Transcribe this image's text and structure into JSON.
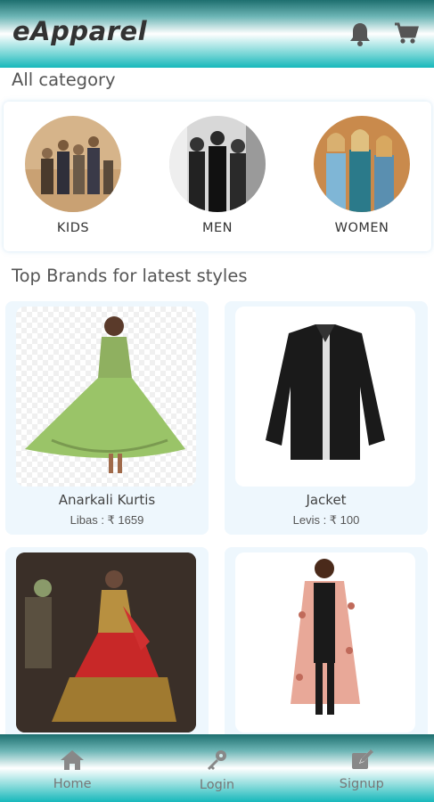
{
  "header": {
    "title": "eApparel",
    "icons": [
      "bell-icon",
      "cart-icon"
    ]
  },
  "categories_section": {
    "title": "All category",
    "items": [
      {
        "label": "KIDS"
      },
      {
        "label": "MEN"
      },
      {
        "label": "WOMEN"
      }
    ]
  },
  "brands_section": {
    "title": "Top Brands for latest styles",
    "products": [
      {
        "name": "Anarkali Kurtis",
        "price": "Libas :  ₹ 1659"
      },
      {
        "name": "Jacket",
        "price": "Levis :  ₹ 100"
      },
      {
        "name": "",
        "price": ""
      },
      {
        "name": "",
        "price": ""
      }
    ]
  },
  "bottom_nav": {
    "items": [
      {
        "label": "Home",
        "icon": "home-icon"
      },
      {
        "label": "Login",
        "icon": "key-icon"
      },
      {
        "label": "Signup",
        "icon": "signup-icon"
      }
    ]
  },
  "colors": {
    "header_teal": "#17b8bb",
    "card_bg": "#eef7fd",
    "text_dark": "#333333"
  }
}
